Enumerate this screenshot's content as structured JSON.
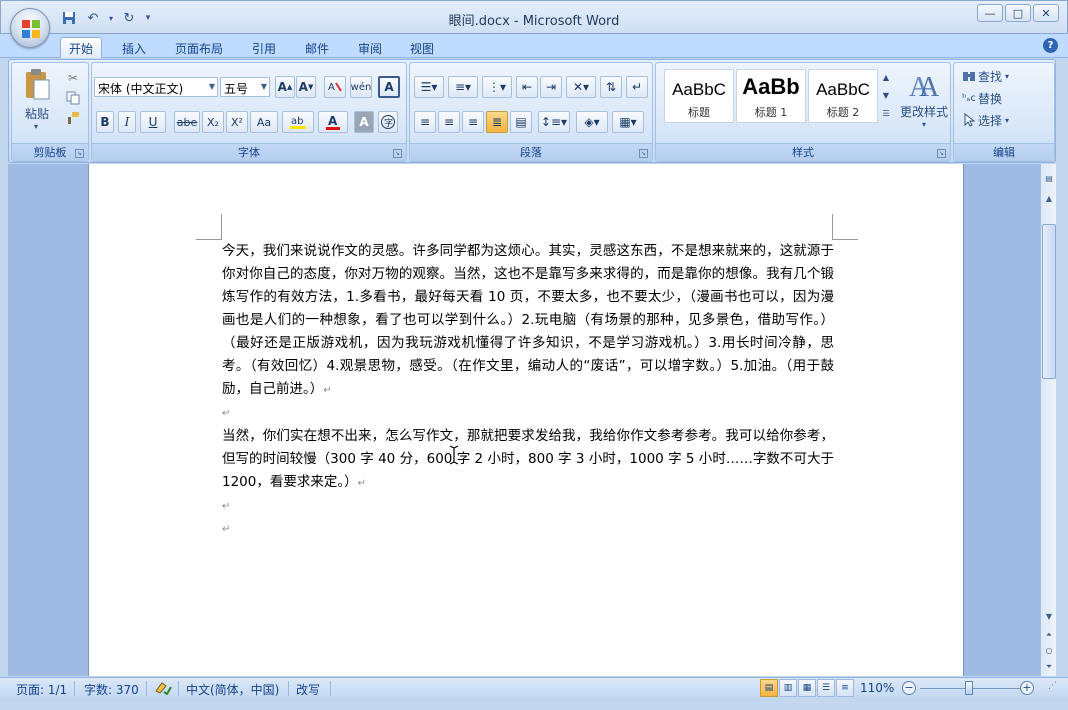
{
  "window": {
    "title": "眼间.docx - Microsoft Word"
  },
  "tabs": [
    "开始",
    "插入",
    "页面布局",
    "引用",
    "邮件",
    "审阅",
    "视图"
  ],
  "ribbon": {
    "clipboard": {
      "label": "剪贴板",
      "paste": "粘贴"
    },
    "font": {
      "label": "字体",
      "font_name": "宋体 (中文正文)",
      "font_size": "五号",
      "bold": "B",
      "italic": "I",
      "underline": "U",
      "strike": "abe",
      "sub": "X₂",
      "sup": "X²",
      "case": "Aa"
    },
    "paragraph": {
      "label": "段落"
    },
    "styles": {
      "label": "样式",
      "change": "更改样式",
      "items": [
        {
          "sample": "AaBbC",
          "name": "标题"
        },
        {
          "sample": "AaBb",
          "name": "标题 1"
        },
        {
          "sample": "AaBbC",
          "name": "标题 2"
        }
      ]
    },
    "editing": {
      "label": "编辑",
      "find": "查找",
      "replace": "替换",
      "select": "选择"
    }
  },
  "document": {
    "p1": "今天，我们来说说作文的灵感。许多同学都为这烦心。其实，灵感这东西，不是想来就来的，这就源于你对你自己的态度，你对万物的观察。当然，这也不是靠写多来求得的，而是靠你的想像。我有几个锻炼写作的有效方法，1.多看书，最好每天看 10 页，不要太多，也不要太少，（漫画书也可以，因为漫画也是人们的一种想象，看了也可以学到什么。）2.玩电脑（有场景的那种，见多景色，借助写作。）（最好还是正版游戏机，因为我玩游戏机懂得了许多知识，不是学习游戏机。）3.用长时间冷静，思考。（有效回忆）4.观景思物，感受。（在作文里，编动人的“废话”，可以增字数。）5.加油。（用于鼓励，自己前进。）",
    "p2": "当然，你们实在想不出来，怎么写作文，那就把要求发给我，我给你作文参考参考。我可以给你参考，但写的时间较慢（300 字 40 分，600 字 2 小时，800 字 3 小时，1000 字 5 小时……字数不可大于 1200，看要求来定。）",
    "para_mark": "↵"
  },
  "status": {
    "page": "页面: 1/1",
    "words": "字数: 370",
    "language": "中文(简体，中国)",
    "mode": "改写",
    "zoom": "110%"
  }
}
